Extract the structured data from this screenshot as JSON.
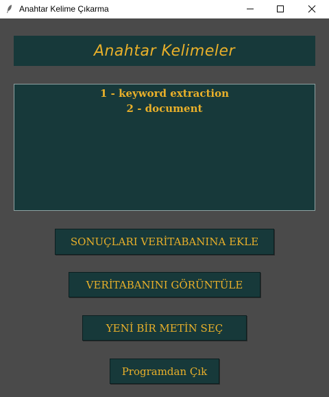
{
  "window": {
    "title": "Anahtar Kelime Çıkarma",
    "icons": {
      "app": "feather-icon",
      "minimize": "minimize-icon",
      "maximize": "maximize-icon",
      "close": "close-icon"
    }
  },
  "header": {
    "title": "Anahtar Kelimeler"
  },
  "results": {
    "lines": [
      "1 - keyword extraction",
      "2 - document"
    ]
  },
  "buttons": {
    "save_results": "SONUÇLARI VERİTABANINA EKLE",
    "view_database": "VERİTABANINI GÖRÜNTÜLE",
    "select_new_text": "YENİ BİR METİN SEÇ",
    "exit": "Programdan Çık"
  },
  "colors": {
    "background": "#4a4a4a",
    "panel": "#17393a",
    "accent_text": "#e9b02a"
  }
}
